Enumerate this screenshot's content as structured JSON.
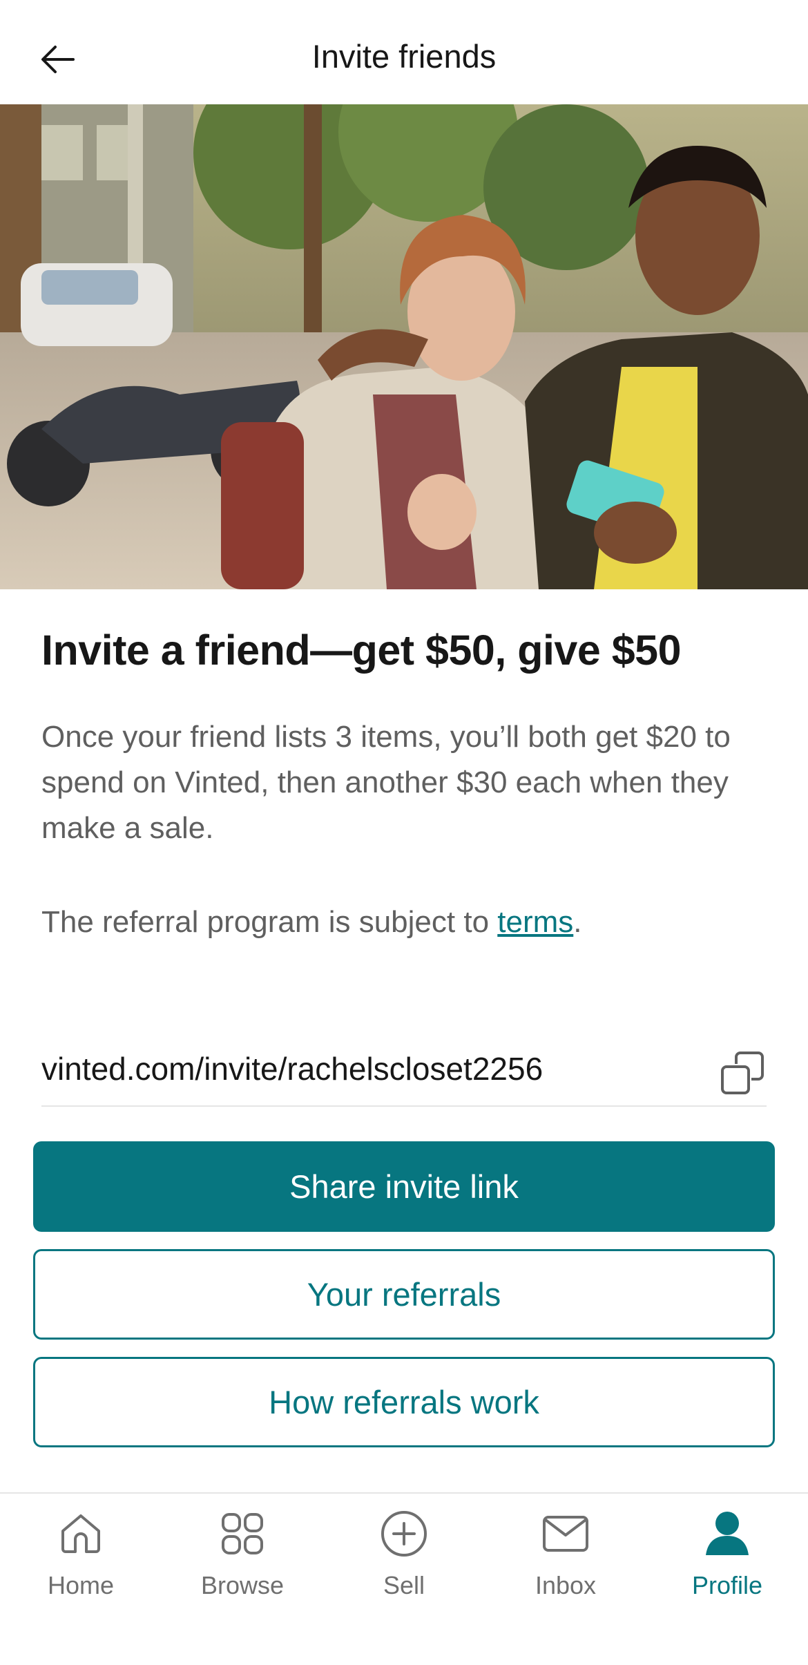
{
  "header": {
    "title": "Invite friends",
    "back_icon": "arrow-left-icon"
  },
  "hero": {
    "alt": "Two friends smiling and looking at a phone on a city street"
  },
  "content": {
    "headline": "Invite a friend—get $50, give $50",
    "description": "Once your friend lists 3 items, you’ll both get $20 to spend on Vinted, then another $30 each when they make a sale.",
    "terms_prefix": "The referral program is subject to ",
    "terms_link": "terms",
    "terms_suffix": "."
  },
  "invite_link": {
    "value": "vinted.com/invite/rachelscloset2256",
    "copy_icon": "copy-icon"
  },
  "buttons": {
    "share": "Share invite link",
    "referrals": "Your referrals",
    "how": "How referrals work"
  },
  "nav": {
    "items": [
      {
        "label": "Home",
        "icon": "home-icon",
        "active": false
      },
      {
        "label": "Browse",
        "icon": "grid-icon",
        "active": false
      },
      {
        "label": "Sell",
        "icon": "plus-circle-icon",
        "active": false
      },
      {
        "label": "Inbox",
        "icon": "envelope-icon",
        "active": false
      },
      {
        "label": "Profile",
        "icon": "user-icon",
        "active": true
      }
    ]
  },
  "colors": {
    "accent": "#077680",
    "text": "#171717",
    "muted": "#5f5f5f",
    "divider": "#e5e5e5"
  }
}
